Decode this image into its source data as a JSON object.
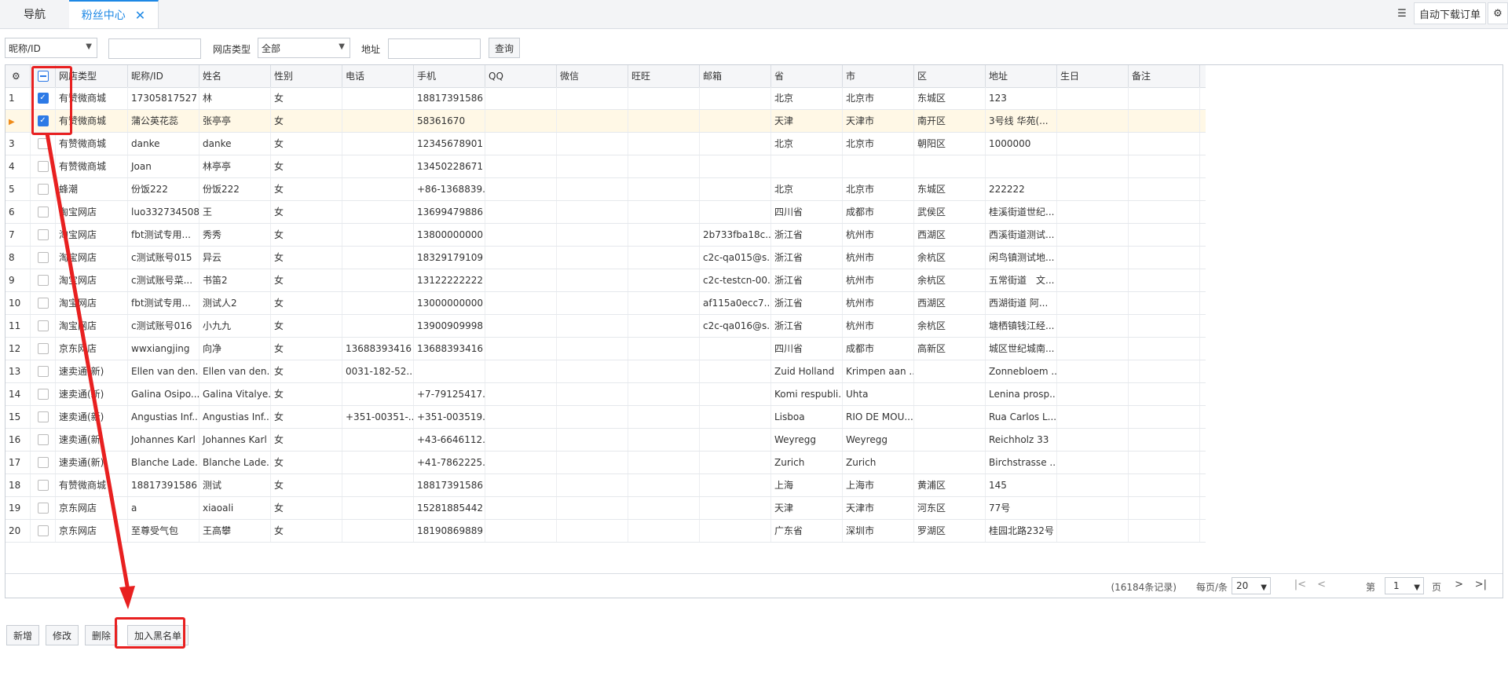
{
  "tabs": [
    {
      "label": "导航"
    },
    {
      "label": "粉丝中心"
    }
  ],
  "toolbar_right": {
    "download_label": "自动下载订单"
  },
  "search": {
    "field_select": "昵称/ID",
    "shop_type_label": "网店类型",
    "shop_type_value": "全部",
    "address_label": "地址",
    "query_label": "查询"
  },
  "columns": [
    "网店类型",
    "昵称/ID",
    "姓名",
    "性别",
    "电话",
    "手机",
    "QQ",
    "微信",
    "旺旺",
    "邮箱",
    "省",
    "市",
    "区",
    "地址",
    "生日",
    "备注"
  ],
  "rows": [
    {
      "idx": "1",
      "checked": true,
      "marker": false,
      "cells": [
        "有赞微商城",
        "17305817527",
        "林",
        "女",
        "",
        "18817391586",
        "",
        "",
        "",
        "",
        "北京",
        "北京市",
        "东城区",
        "123",
        "",
        ""
      ]
    },
    {
      "idx": "",
      "checked": true,
      "marker": true,
      "cells": [
        "有赞微商城",
        "蒲公英花蕊",
        "张亭亭",
        "女",
        "",
        "58361670",
        "",
        "",
        "",
        "",
        "天津",
        "天津市",
        "南开区",
        "3号线 华苑(...",
        "",
        ""
      ]
    },
    {
      "idx": "3",
      "checked": false,
      "marker": false,
      "cells": [
        "有赞微商城",
        "danke",
        "danke",
        "女",
        "",
        "12345678901",
        "",
        "",
        "",
        "",
        "北京",
        "北京市",
        "朝阳区",
        "1000000",
        "",
        ""
      ]
    },
    {
      "idx": "4",
      "checked": false,
      "marker": false,
      "cells": [
        "有赞微商城",
        "Joan",
        "林亭亭",
        "女",
        "",
        "13450228671",
        "",
        "",
        "",
        "",
        "",
        "",
        "",
        "",
        "",
        ""
      ]
    },
    {
      "idx": "5",
      "checked": false,
      "marker": false,
      "cells": [
        "蜂潮",
        "份饭222",
        "份饭222",
        "女",
        "",
        "+86-1368839...",
        "",
        "",
        "",
        "",
        "北京",
        "北京市",
        "东城区",
        "222222",
        "",
        ""
      ]
    },
    {
      "idx": "6",
      "checked": false,
      "marker": false,
      "cells": [
        "淘宝网店",
        "luo332734508",
        "王",
        "女",
        "",
        "13699479886",
        "",
        "",
        "",
        "",
        "四川省",
        "成都市",
        "武侯区",
        "桂溪街道世纪...",
        "",
        ""
      ]
    },
    {
      "idx": "7",
      "checked": false,
      "marker": false,
      "cells": [
        "淘宝网店",
        "fbt测试专用...",
        "秀秀",
        "女",
        "",
        "13800000000",
        "",
        "",
        "",
        "2b733fba18c...",
        "浙江省",
        "杭州市",
        "西湖区",
        "西溪街道测试...",
        "",
        ""
      ]
    },
    {
      "idx": "8",
      "checked": false,
      "marker": false,
      "cells": [
        "淘宝网店",
        "c测试账号015",
        "异云",
        "女",
        "",
        "18329179109",
        "",
        "",
        "",
        "c2c-qa015@s...",
        "浙江省",
        "杭州市",
        "余杭区",
        "闲鸟镇测试地...",
        "",
        ""
      ]
    },
    {
      "idx": "9",
      "checked": false,
      "marker": false,
      "cells": [
        "淘宝网店",
        "c测试账号菜...",
        "书笛2",
        "女",
        "",
        "13122222222",
        "",
        "",
        "",
        "c2c-testcn-00...",
        "浙江省",
        "杭州市",
        "余杭区",
        "五常街道　文...",
        "",
        ""
      ]
    },
    {
      "idx": "10",
      "checked": false,
      "marker": false,
      "cells": [
        "淘宝网店",
        "fbt测试专用...",
        "测试人2",
        "女",
        "",
        "13000000000",
        "",
        "",
        "",
        "af115a0ecc7...",
        "浙江省",
        "杭州市",
        "西湖区",
        "西湖街道 阿...",
        "",
        ""
      ]
    },
    {
      "idx": "11",
      "checked": false,
      "marker": false,
      "cells": [
        "淘宝网店",
        "c测试账号016",
        "小九九",
        "女",
        "",
        "13900909998",
        "",
        "",
        "",
        "c2c-qa016@s...",
        "浙江省",
        "杭州市",
        "余杭区",
        "塘栖镇钱江经...",
        "",
        ""
      ]
    },
    {
      "idx": "12",
      "checked": false,
      "marker": false,
      "cells": [
        "京东网店",
        "wwxiangjing",
        "向净",
        "女",
        "13688393416",
        "13688393416",
        "",
        "",
        "",
        "",
        "四川省",
        "成都市",
        "高新区",
        "城区世纪城南...",
        "",
        ""
      ]
    },
    {
      "idx": "13",
      "checked": false,
      "marker": false,
      "cells": [
        "速卖通(新)",
        "Ellen van den...",
        "Ellen van den...",
        "女",
        "0031-182-52...",
        "",
        "",
        "",
        "",
        "",
        "Zuid Holland",
        "Krimpen aan ...",
        "",
        "Zonnebloem ...",
        "",
        ""
      ]
    },
    {
      "idx": "14",
      "checked": false,
      "marker": false,
      "cells": [
        "速卖通(新)",
        "Galina Osipo...",
        "Galina Vitalye...",
        "女",
        "",
        "+7-79125417...",
        "",
        "",
        "",
        "",
        "Komi respubli...",
        "Uhta",
        "",
        "Lenina prosp...",
        "",
        ""
      ]
    },
    {
      "idx": "15",
      "checked": false,
      "marker": false,
      "cells": [
        "速卖通(新)",
        "Angustias Inf...",
        "Angustias Inf...",
        "女",
        "+351-00351-...",
        "+351-003519...",
        "",
        "",
        "",
        "",
        "Lisboa",
        "RIO DE MOU...",
        "",
        "Rua Carlos L...",
        "",
        ""
      ]
    },
    {
      "idx": "16",
      "checked": false,
      "marker": false,
      "cells": [
        "速卖通(新)",
        "Johannes Karl",
        "Johannes Karl",
        "女",
        "",
        "+43-6646112...",
        "",
        "",
        "",
        "",
        "Weyregg",
        "Weyregg",
        "",
        "Reichholz 33",
        "",
        ""
      ]
    },
    {
      "idx": "17",
      "checked": false,
      "marker": false,
      "cells": [
        "速卖通(新)",
        "Blanche Lade...",
        "Blanche Lade...",
        "女",
        "",
        "+41-7862225...",
        "",
        "",
        "",
        "",
        "Zurich",
        "Zurich",
        "",
        "Birchstrasse ...",
        "",
        ""
      ]
    },
    {
      "idx": "18",
      "checked": false,
      "marker": false,
      "cells": [
        "有赞微商城",
        "18817391586",
        "测试",
        "女",
        "",
        "18817391586",
        "",
        "",
        "",
        "",
        "上海",
        "上海市",
        "黄浦区",
        "145",
        "",
        ""
      ]
    },
    {
      "idx": "19",
      "checked": false,
      "marker": false,
      "cells": [
        "京东网店",
        "a",
        "xiaoali",
        "女",
        "",
        "15281885442",
        "",
        "",
        "",
        "",
        "天津",
        "天津市",
        "河东区",
        "77号",
        "",
        ""
      ]
    },
    {
      "idx": "20",
      "checked": false,
      "marker": false,
      "cells": [
        "京东网店",
        "至尊受气包",
        "王高攀",
        "女",
        "",
        "18190869889",
        "",
        "",
        "",
        "",
        "广东省",
        "深圳市",
        "罗湖区",
        "桂园北路232号",
        "",
        ""
      ]
    }
  ],
  "pager": {
    "total": "(16184条记录)",
    "perpage_label": "每页/条",
    "perpage_value": "20",
    "page_prefix": "第",
    "page_value": "1",
    "page_suffix": "页"
  },
  "actions": {
    "add": "新增",
    "edit": "修改",
    "delete": "删除",
    "blacklist": "加入黑名单"
  },
  "colors": {
    "accent": "#1e88e5",
    "annotation": "#e82020",
    "active_row": "#fff8e6"
  }
}
